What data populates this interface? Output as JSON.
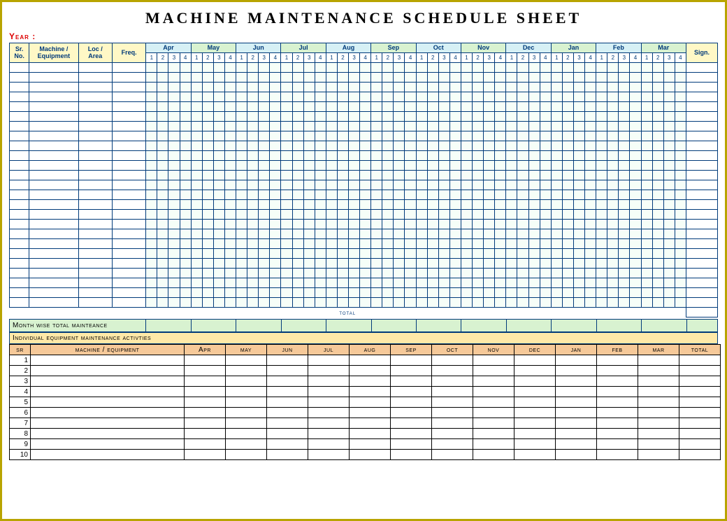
{
  "title": "MACHINE MAINTENANCE SCHEDULE SHEET",
  "year_label": "Year :",
  "main_header": {
    "sr_no": "Sr. No.",
    "machine": "Machine / Equipment",
    "loc": "Loc / Area",
    "freq": "Freq.",
    "sign": "Sign.",
    "months": [
      "Apr",
      "May",
      "Jun",
      "Jul",
      "Aug",
      "Sep",
      "Oct",
      "Nov",
      "Dec",
      "Jan",
      "Feb",
      "Mar"
    ],
    "weeks": [
      "1",
      "2",
      "3",
      "4"
    ]
  },
  "body_row_count": 25,
  "total_label": "total",
  "month_wise_label": "Month wise total mainteance",
  "section_bar": "Individual equipment maintenance activties",
  "activities": {
    "columns": [
      "sr",
      "machine / equipment",
      "Apr",
      "may",
      "jun",
      "jul",
      "aug",
      "sep",
      "oct",
      "nov",
      "dec",
      "jan",
      "feb",
      "mar",
      "total"
    ],
    "rows": [
      1,
      2,
      3,
      4,
      5,
      6,
      7,
      8,
      9,
      10
    ]
  }
}
